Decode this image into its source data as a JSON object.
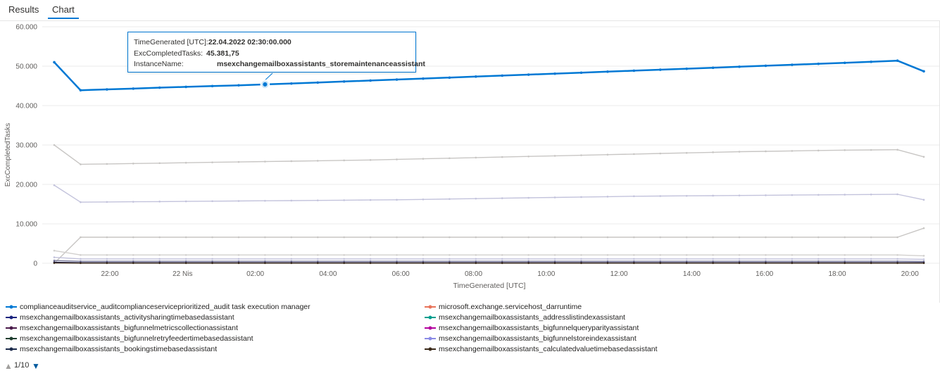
{
  "tabs": {
    "results": "Results",
    "chart": "Chart"
  },
  "chart_data": {
    "type": "line",
    "ylabel": "ExcCompletedTasks",
    "xlabel": "TimeGenerated [UTC]",
    "ylim": [
      0,
      60000
    ],
    "y_ticks": [
      "0",
      "10.000",
      "20.000",
      "30.000",
      "40.000",
      "50.000",
      "60.000"
    ],
    "x_ticks": [
      "22:00",
      "22 Nis",
      "02:00",
      "04:00",
      "06:00",
      "08:00",
      "10:00",
      "12:00",
      "14:00",
      "16:00",
      "18:00",
      "20:00"
    ],
    "grid": true,
    "series": [
      {
        "name": "msexchangemailboxassistants_storemaintenanceassistant",
        "color": "#0078d4",
        "highlighted": true,
        "values": [
          51000,
          43900,
          44100,
          44300,
          44550,
          44750,
          44950,
          45150,
          45381,
          45600,
          45850,
          46100,
          46350,
          46600,
          46850,
          47100,
          47350,
          47600,
          47850,
          48100,
          48350,
          48600,
          48850,
          49100,
          49350,
          49600,
          49850,
          50100,
          50350,
          50600,
          50850,
          51100,
          51400,
          48700
        ]
      },
      {
        "color": "#c8c6c4",
        "highlighted": false,
        "values": [
          30000,
          25100,
          25200,
          25300,
          25400,
          25500,
          25600,
          25700,
          25800,
          25900,
          26000,
          26100,
          26200,
          26350,
          26500,
          26650,
          26800,
          26950,
          27100,
          27250,
          27400,
          27550,
          27700,
          27850,
          28000,
          28150,
          28300,
          28400,
          28500,
          28600,
          28700,
          28750,
          28800,
          27000
        ]
      },
      {
        "color": "#c3c3dc",
        "highlighted": false,
        "values": [
          19800,
          15500,
          15550,
          15600,
          15650,
          15700,
          15750,
          15800,
          15850,
          15900,
          15950,
          16000,
          16050,
          16100,
          16200,
          16300,
          16400,
          16500,
          16600,
          16700,
          16800,
          16900,
          17000,
          17050,
          17100,
          17150,
          17200,
          17250,
          17300,
          17350,
          17400,
          17450,
          17500,
          16100
        ]
      },
      {
        "color": "#c8c6c4",
        "highlighted": false,
        "values": [
          0,
          6600,
          6600,
          6600,
          6600,
          6600,
          6600,
          6600,
          6600,
          6600,
          6600,
          6600,
          6600,
          6600,
          6600,
          6600,
          6600,
          6600,
          6600,
          6600,
          6600,
          6600,
          6600,
          6600,
          6600,
          6600,
          6600,
          6600,
          6600,
          6600,
          6600,
          6600,
          6600,
          8900
        ]
      },
      {
        "color": "#d2d0ce",
        "highlighted": false,
        "values": [
          3200,
          2100,
          2100,
          2100,
          2100,
          2100,
          2100,
          2100,
          2100,
          2100,
          2100,
          2100,
          2100,
          2100,
          2100,
          2100,
          2100,
          2100,
          2100,
          2100,
          2100,
          2100,
          2100,
          2100,
          2100,
          2100,
          2100,
          2100,
          2100,
          2100,
          2100,
          2100,
          2100,
          1900
        ]
      },
      {
        "color": "#c3c3dc",
        "highlighted": false,
        "values": [
          1500,
          1100,
          1100,
          1100,
          1100,
          1100,
          1100,
          1100,
          1100,
          1100,
          1100,
          1100,
          1100,
          1100,
          1100,
          1100,
          1100,
          1100,
          1100,
          1100,
          1100,
          1100,
          1100,
          1100,
          1100,
          1100,
          1100,
          1100,
          1100,
          1100,
          1100,
          1100,
          1100,
          1000
        ]
      },
      {
        "color": "#7a7a9a",
        "highlighted": false,
        "values": [
          700,
          500,
          500,
          500,
          500,
          500,
          500,
          500,
          500,
          500,
          500,
          500,
          500,
          500,
          500,
          500,
          500,
          500,
          500,
          500,
          500,
          500,
          500,
          500,
          500,
          500,
          500,
          500,
          500,
          500,
          500,
          500,
          500,
          450
        ]
      },
      {
        "color": "#1a1a4a",
        "highlighted": false,
        "values": [
          250,
          150,
          150,
          150,
          150,
          150,
          150,
          150,
          150,
          150,
          150,
          150,
          150,
          150,
          150,
          150,
          150,
          150,
          150,
          150,
          150,
          150,
          150,
          150,
          150,
          150,
          150,
          150,
          150,
          150,
          150,
          150,
          150,
          150
        ]
      },
      {
        "color": "#3b2a1a",
        "highlighted": false,
        "values": [
          80,
          40,
          40,
          40,
          40,
          40,
          40,
          40,
          40,
          40,
          40,
          40,
          40,
          40,
          40,
          40,
          40,
          40,
          40,
          40,
          40,
          40,
          40,
          40,
          40,
          40,
          40,
          40,
          40,
          40,
          40,
          40,
          40,
          40
        ]
      }
    ],
    "legend": [
      {
        "name": "complianceauditservice_auditcomplianceserviceprioritized_audit task execution manager",
        "color": "#0078d4"
      },
      {
        "name": "microsoft.exchange.servicehost_darruntime",
        "color": "#e8735a"
      },
      {
        "name": "msexchangemailboxassistants_activitysharingtimebasedassistant",
        "color": "#1a237e"
      },
      {
        "name": "msexchangemailboxassistants_addresslistindexassistant",
        "color": "#009e8f"
      },
      {
        "name": "msexchangemailboxassistants_bigfunnelmetricscollectionassistant",
        "color": "#4a1a4a"
      },
      {
        "name": "msexchangemailboxassistants_bigfunnelqueryparityassistant",
        "color": "#b4009e"
      },
      {
        "name": "msexchangemailboxassistants_bigfunnelretryfeedertimebasedassistant",
        "color": "#1e3d2f"
      },
      {
        "name": "msexchangemailboxassistants_bigfunnelstoreindexassistant",
        "color": "#8a8ae6"
      },
      {
        "name": "msexchangemailboxassistants_bookingstimebasedassistant",
        "color": "#1b2a4a"
      },
      {
        "name": "msexchangemailboxassistants_calculatedvaluetimebasedassistant",
        "color": "#3b2a1a"
      }
    ],
    "tooltip": {
      "time_key": "TimeGenerated [UTC]:",
      "time_value": "22.04.2022 02:30:00.000",
      "tasks_key": "ExcCompletedTasks:",
      "tasks_value": "45.381,75",
      "instance_key": "InstanceName:",
      "instance_value": "msexchangemailboxassistants_storemaintenanceassistant",
      "point_index": 8
    }
  },
  "pager": {
    "up": "▲",
    "text": "1/10",
    "down": "▼"
  }
}
